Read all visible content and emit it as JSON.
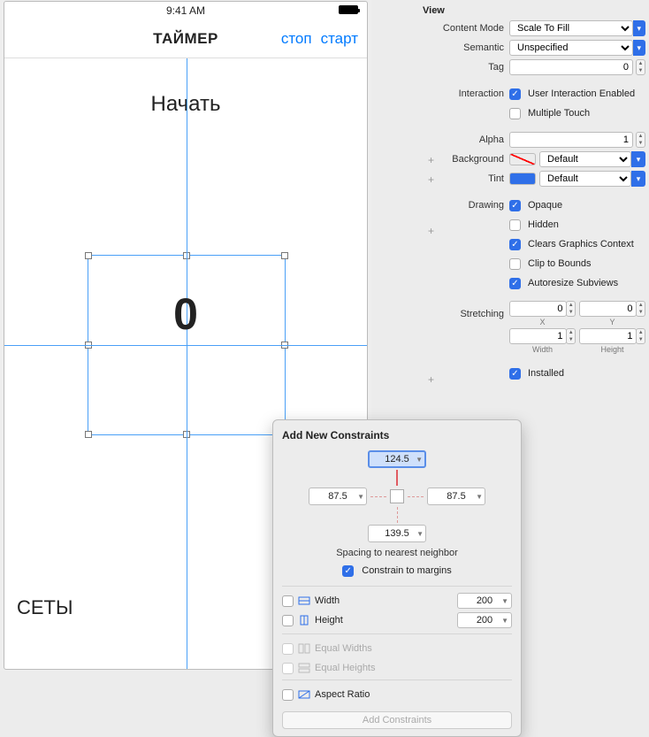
{
  "phone": {
    "time": "9:41 AM",
    "title": "ТАЙМЕР",
    "btn_stop": "стоп",
    "btn_start": "старт",
    "begin": "Начать",
    "zero": "0",
    "sets": "СЕТЫ"
  },
  "inspector": {
    "section": "View",
    "content_mode": {
      "label": "Content Mode",
      "value": "Scale To Fill"
    },
    "semantic": {
      "label": "Semantic",
      "value": "Unspecified"
    },
    "tag": {
      "label": "Tag",
      "value": "0"
    },
    "interaction": {
      "label": "Interaction",
      "user_interaction": "User Interaction Enabled",
      "multiple_touch": "Multiple Touch"
    },
    "alpha": {
      "label": "Alpha",
      "value": "1"
    },
    "background": {
      "label": "Background",
      "value": "Default"
    },
    "tint": {
      "label": "Tint",
      "value": "Default"
    },
    "drawing": {
      "label": "Drawing",
      "opaque": "Opaque",
      "hidden": "Hidden",
      "clears": "Clears Graphics Context",
      "clip": "Clip to Bounds",
      "autoresize": "Autoresize Subviews"
    },
    "stretching": {
      "label": "Stretching",
      "x": "0",
      "y": "0",
      "w": "1",
      "h": "1",
      "x_lab": "X",
      "y_lab": "Y",
      "w_lab": "Width",
      "h_lab": "Height"
    },
    "installed": "Installed"
  },
  "popover": {
    "title": "Add New Constraints",
    "top": "124.5",
    "left": "87.5",
    "right": "87.5",
    "bottom": "139.5",
    "spacing_note": "Spacing to nearest neighbor",
    "constrain_margins": "Constrain to margins",
    "width_label": "Width",
    "width_value": "200",
    "height_label": "Height",
    "height_value": "200",
    "equal_widths": "Equal Widths",
    "equal_heights": "Equal Heights",
    "aspect_ratio": "Aspect Ratio",
    "add_button": "Add Constraints"
  }
}
